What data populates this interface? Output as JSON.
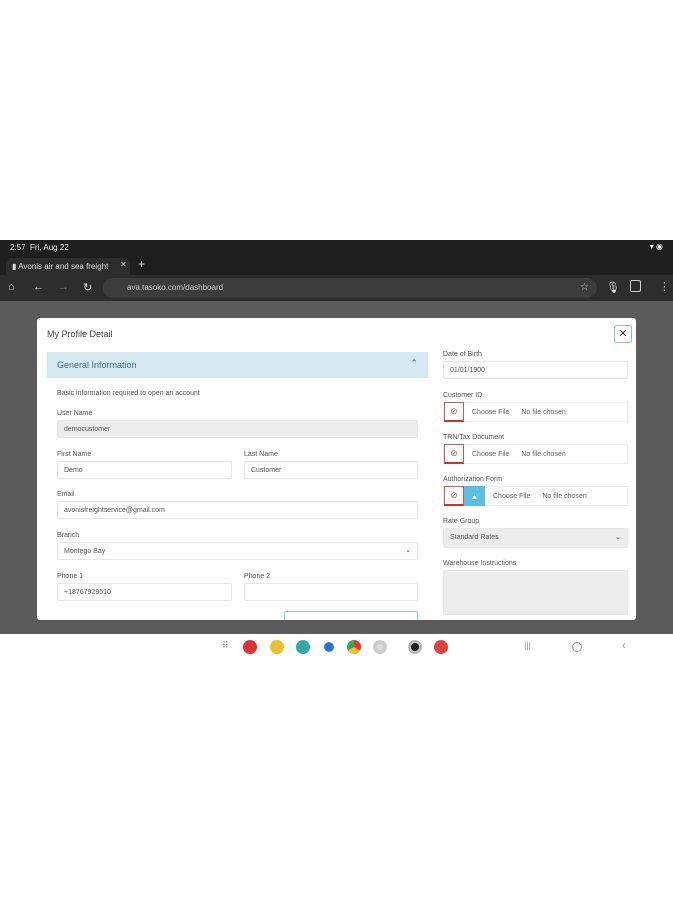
{
  "status": {
    "time": "2:57",
    "date": "Fri, Aug 22"
  },
  "browser": {
    "tab_title": "Avonis air and sea freight",
    "url": "ava.tasoko.com/dashboard"
  },
  "modal": {
    "title": "My Profile Detail",
    "close": "✕",
    "section": {
      "title": "General Information",
      "subtitle": "Basic information required to open an account"
    },
    "fields": {
      "username": {
        "label": "User Name",
        "value": "democustomer"
      },
      "first_name": {
        "label": "First Name",
        "value": "Demo"
      },
      "last_name": {
        "label": "Last Name",
        "value": "Customer"
      },
      "email": {
        "label": "Email",
        "value": "avonisfreightservice@gmail.com"
      },
      "branch": {
        "label": "Branch",
        "value": "Montego Bay"
      },
      "phone1": {
        "label": "Phone 1",
        "value": "+18767929510"
      },
      "phone2": {
        "label": "Phone 2",
        "value": ""
      },
      "dob": {
        "label": "Date of Birth",
        "value": "01/01/1900"
      },
      "customer_id": {
        "label": "Customer ID",
        "choose": "Choose File",
        "status": "No file chosen"
      },
      "trn": {
        "label": "TRN/Tax Document",
        "choose": "Choose File",
        "status": "No file chosen"
      },
      "auth": {
        "label": "Authorization Form",
        "choose": "Choose File",
        "status": "No file chosen"
      },
      "rate_group": {
        "label": "Rate Group",
        "value": "Standard Rates"
      },
      "warehouse": {
        "label": "Warehouse Instructions",
        "value": ""
      }
    }
  },
  "colors": {
    "section_bg": "#d4e9f2",
    "accent": "#5bc0de",
    "danger": "#d9534f"
  }
}
